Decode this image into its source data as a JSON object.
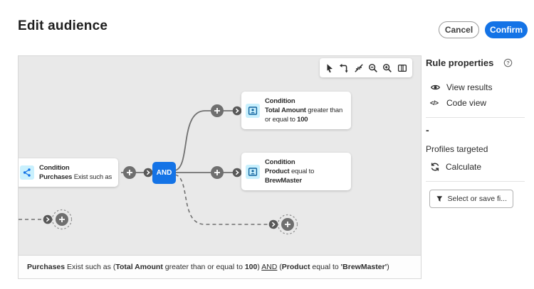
{
  "header": {
    "title": "Edit audience",
    "cancel_label": "Cancel",
    "confirm_label": "Confirm"
  },
  "toolbar": {
    "tools": [
      "select-tool",
      "reset-layout-tool",
      "fit-view-tool",
      "zoom-out-tool",
      "zoom-in-tool",
      "minimap-tool"
    ]
  },
  "canvas": {
    "operator_label": "AND",
    "nodes": [
      {
        "id": "purchases",
        "title": "Condition",
        "icon": "share-network-icon",
        "segments": [
          {
            "t": "Purchases",
            "b": true
          },
          {
            "t": " Exist such as"
          }
        ]
      },
      {
        "id": "total-amount",
        "title": "Condition",
        "icon": "profile-card-icon",
        "segments": [
          {
            "t": "Total Amount",
            "b": true
          },
          {
            "t": " greater than or equal to "
          },
          {
            "t": "100",
            "b": true
          }
        ]
      },
      {
        "id": "product",
        "title": "Condition",
        "icon": "profile-card-icon",
        "segments": [
          {
            "t": "Product",
            "b": true
          },
          {
            "t": " equal to "
          },
          {
            "t": "BrewMaster",
            "b": true
          }
        ]
      }
    ],
    "summary_segments": [
      {
        "t": "Purchases",
        "b": true
      },
      {
        "t": " Exist such as ("
      },
      {
        "t": "Total Amount",
        "b": true
      },
      {
        "t": " greater than or equal to "
      },
      {
        "t": "100",
        "b": true
      },
      {
        "t": ") "
      },
      {
        "t": "AND",
        "u": true
      },
      {
        "t": " ("
      },
      {
        "t": "Product",
        "b": true
      },
      {
        "t": " equal to "
      },
      {
        "t": "'BrewMaster'",
        "b": true
      },
      {
        "t": ")"
      }
    ]
  },
  "panel": {
    "title": "Rule properties",
    "help_glyph": "?",
    "actions": [
      {
        "label": "View results",
        "icon": "eye-icon"
      },
      {
        "label": "Code view",
        "icon": "code-icon",
        "icon_glyph": "</>"
      }
    ],
    "profiles_count": "-",
    "profiles_label": "Profiles targeted",
    "calculate_label": "Calculate",
    "filter_button_label": "Select or save fi..."
  },
  "colors": {
    "accent_blue": "#1473e6",
    "canvas_bg": "#e9e9e9",
    "connector_gray": "#707070",
    "node_icon_bg": "#c9f0fd"
  }
}
